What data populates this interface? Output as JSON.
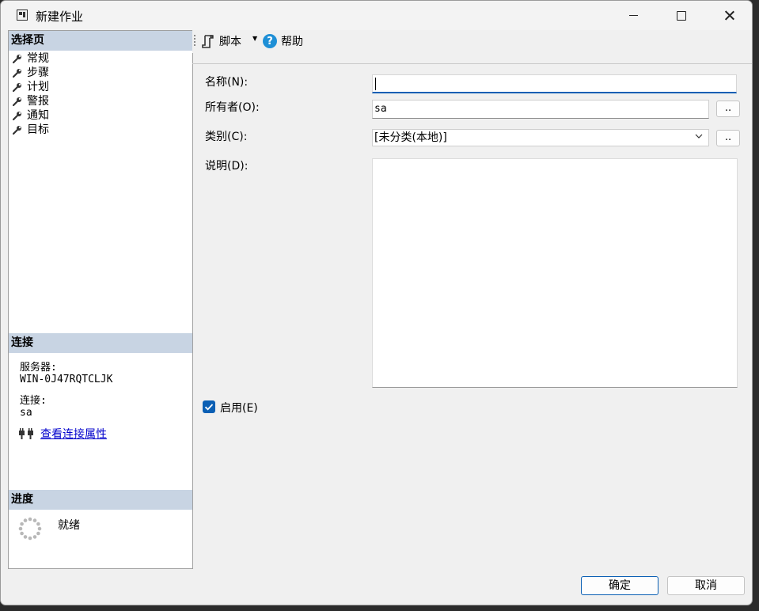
{
  "window": {
    "title": "新建作业"
  },
  "left": {
    "pages_header": "选择页",
    "pages": [
      {
        "label": "常规"
      },
      {
        "label": "步骤"
      },
      {
        "label": "计划"
      },
      {
        "label": "警报"
      },
      {
        "label": "通知"
      },
      {
        "label": "目标"
      }
    ],
    "connection_header": "连接",
    "server_label": "服务器:",
    "server_value": "WIN-0J47RQTCLJK",
    "connection_label": "连接:",
    "connection_value": "sa",
    "view_properties_link": "查看连接属性",
    "progress_header": "进度",
    "progress_status": "就绪"
  },
  "toolbar": {
    "script_label": "脚本",
    "help_label": "帮助"
  },
  "form": {
    "name_label": "名称(N):",
    "name_value": "",
    "owner_label": "所有者(O):",
    "owner_value": "sa",
    "owner_browse": "..",
    "category_label": "类别(C):",
    "category_value": "[未分类(本地)]",
    "category_browse": "..",
    "description_label": "说明(D):",
    "description_value": "",
    "enabled_label": "启用(E)",
    "enabled_checked": true
  },
  "buttons": {
    "ok": "确定",
    "cancel": "取消"
  },
  "colors": {
    "accent": "#0a5fb4",
    "section_header": "#c8d4e3",
    "link": "#0000cc"
  }
}
